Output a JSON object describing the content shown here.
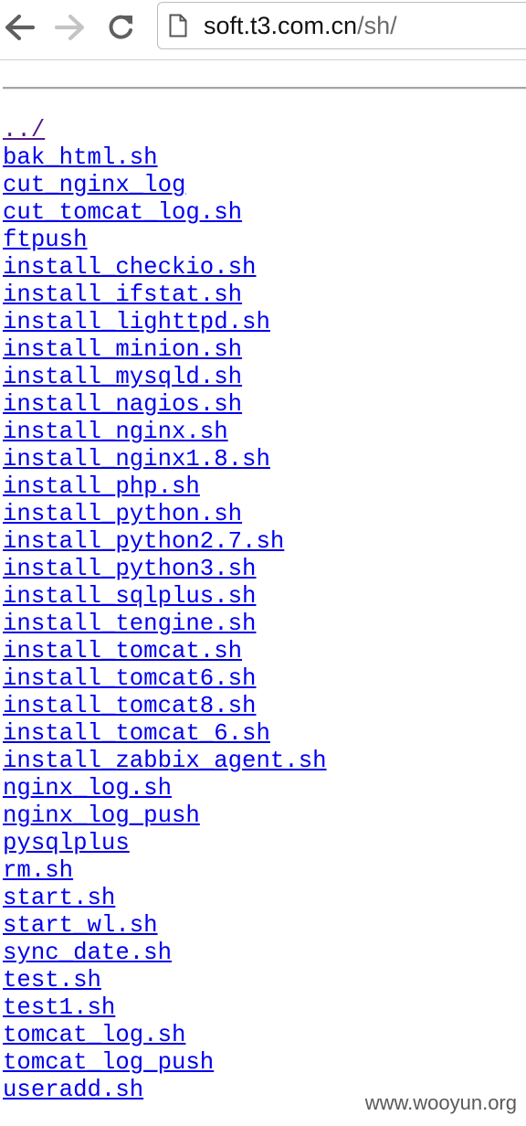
{
  "browser": {
    "url_host": "soft.t3.com.cn",
    "url_path": "/sh/",
    "icons": {
      "back": "back-arrow-icon",
      "forward": "forward-arrow-icon",
      "reload": "reload-icon",
      "page": "page-icon"
    }
  },
  "listing": {
    "parent_link": "../",
    "files": [
      "bak_html.sh",
      "cut_nginx_log",
      "cut_tomcat_log.sh",
      "ftpush",
      "install_checkio.sh",
      "install_ifstat.sh",
      "install_lighttpd.sh",
      "install_minion.sh",
      "install_mysqld.sh",
      "install_nagios.sh",
      "install_nginx.sh",
      "install_nginx1.8.sh",
      "install_php.sh",
      "install_python.sh",
      "install_python2.7.sh",
      "install_python3.sh",
      "install_sqlplus.sh",
      "install_tengine.sh",
      "install_tomcat.sh",
      "install_tomcat6.sh",
      "install_tomcat8.sh",
      "install_tomcat_6.sh",
      "install_zabbix_agent.sh",
      "nginx_log.sh",
      "nginx_log_push",
      "pysqlplus",
      "rm.sh",
      "start.sh",
      "start_wl.sh",
      "sync_date.sh",
      "test.sh",
      "test1.sh",
      "tomcat_log.sh",
      "tomcat_log_push",
      "useradd.sh"
    ]
  },
  "watermark": "www.wooyun.org",
  "colors": {
    "link": "#0000ee",
    "visited_link": "#551a8b",
    "toolbar_icon": "#5f5f5f"
  }
}
